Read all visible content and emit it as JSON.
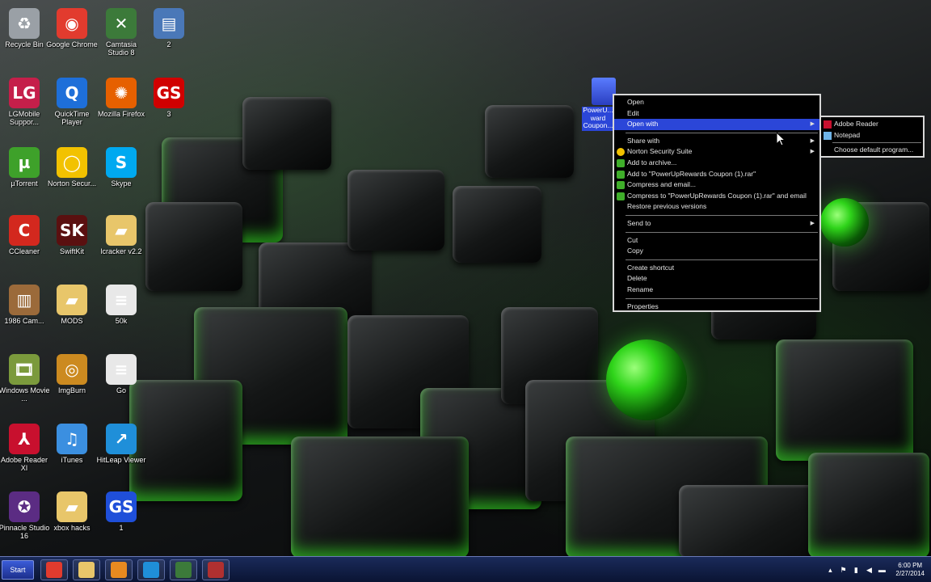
{
  "desktop": {
    "icons": [
      {
        "label": "Recycle Bin",
        "icon": "recycle-bin-icon",
        "color": "#9aa0a6",
        "glyph": "♻"
      },
      {
        "label": "Google Chrome",
        "icon": "chrome-icon",
        "color": "#e23b2e",
        "glyph": "◉"
      },
      {
        "label": "Camtasia Studio 8",
        "icon": "camtasia-icon",
        "color": "#3c7a3a",
        "glyph": "✕"
      },
      {
        "label": "2",
        "icon": "image-file-icon",
        "color": "#4a78b8",
        "glyph": "▤"
      },
      {
        "label": "LGMobile Suppor...",
        "icon": "lg-icon",
        "color": "#c51f4a",
        "glyph": "LG"
      },
      {
        "label": "QuickTime Player",
        "icon": "quicktime-icon",
        "color": "#1e6fd9",
        "glyph": "Q"
      },
      {
        "label": "Mozilla Firefox",
        "icon": "firefox-icon",
        "color": "#e66000",
        "glyph": "✺"
      },
      {
        "label": "3",
        "icon": "gamestop-icon",
        "color": "#d00000",
        "glyph": "GS"
      },
      {
        "label": "µTorrent",
        "icon": "utorrent-icon",
        "color": "#3ea12a",
        "glyph": "µ"
      },
      {
        "label": "Norton Secur...",
        "icon": "norton-icon",
        "color": "#f2c200",
        "glyph": "◯"
      },
      {
        "label": "Skype",
        "icon": "skype-icon",
        "color": "#00a9f0",
        "glyph": "S"
      },
      {
        "label": "CCleaner",
        "icon": "ccleaner-icon",
        "color": "#d3281e",
        "glyph": "C"
      },
      {
        "label": "SwiftKit",
        "icon": "swiftkit-icon",
        "color": "#5a1010",
        "glyph": "SK"
      },
      {
        "label": "lcracker v2.2",
        "icon": "folder-icon",
        "color": "#e8c66a",
        "glyph": "▰"
      },
      {
        "label": "1986 Cam...",
        "icon": "document-icon",
        "color": "#9b6a3a",
        "glyph": "▥"
      },
      {
        "label": "MODS",
        "icon": "folder-icon",
        "color": "#e8c66a",
        "glyph": "▰"
      },
      {
        "label": "50k",
        "icon": "text-file-icon",
        "color": "#e8e8e8",
        "glyph": "≡"
      },
      {
        "label": "Windows Movie ...",
        "icon": "movie-maker-icon",
        "color": "#7b9a3c",
        "glyph": "🎞"
      },
      {
        "label": "ImgBurn",
        "icon": "imgburn-icon",
        "color": "#cc8a20",
        "glyph": "◎"
      },
      {
        "label": "Go",
        "icon": "text-file-icon",
        "color": "#e8e8e8",
        "glyph": "≡"
      },
      {
        "label": "Adobe Reader XI",
        "icon": "adobe-reader-icon",
        "color": "#c8102e",
        "glyph": "⅄"
      },
      {
        "label": "iTunes",
        "icon": "itunes-icon",
        "color": "#3b8fe0",
        "glyph": "♫"
      },
      {
        "label": "HitLeap Viewer",
        "icon": "hitleap-icon",
        "color": "#1f8fd9",
        "glyph": "↗"
      },
      {
        "label": "Pinnacle Studio 16",
        "icon": "pinnacle-icon",
        "color": "#5b2c83",
        "glyph": "✪"
      },
      {
        "label": "xbox hacks",
        "icon": "folder-icon",
        "color": "#e8c66a",
        "glyph": "▰"
      },
      {
        "label": "1",
        "icon": "gamestop-icon",
        "color": "#1f4fd9",
        "glyph": "GS"
      }
    ],
    "selected_icon_label": "PowerU... ward Coupon..."
  },
  "context_menu": {
    "items": [
      {
        "label": "Open",
        "type": "item",
        "icon": ""
      },
      {
        "label": "Edit",
        "type": "item",
        "icon": ""
      },
      {
        "label": "Open with",
        "type": "submenu",
        "icon": "",
        "highlighted": true
      },
      {
        "type": "sep"
      },
      {
        "label": "Share with",
        "type": "submenu",
        "icon": ""
      },
      {
        "label": "Norton Security Suite",
        "type": "submenu",
        "icon": "norton-icon",
        "color": "#f2c200"
      },
      {
        "label": "Add to archive...",
        "type": "item",
        "icon": "winrar-icon",
        "color": "#3fae2a"
      },
      {
        "label": "Add to \"PowerUpRewards Coupon (1).rar\"",
        "type": "item",
        "icon": "winrar-icon",
        "color": "#3fae2a"
      },
      {
        "label": "Compress and email...",
        "type": "item",
        "icon": "winrar-icon",
        "color": "#3fae2a"
      },
      {
        "label": "Compress to \"PowerUpRewards Coupon (1).rar\" and email",
        "type": "item",
        "icon": "winrar-icon",
        "color": "#3fae2a"
      },
      {
        "label": "Restore previous versions",
        "type": "item",
        "icon": ""
      },
      {
        "type": "sep"
      },
      {
        "label": "Send to",
        "type": "submenu",
        "icon": ""
      },
      {
        "type": "sep"
      },
      {
        "label": "Cut",
        "type": "item",
        "icon": ""
      },
      {
        "label": "Copy",
        "type": "item",
        "icon": ""
      },
      {
        "type": "sep"
      },
      {
        "label": "Create shortcut",
        "type": "item",
        "icon": ""
      },
      {
        "label": "Delete",
        "type": "item",
        "icon": ""
      },
      {
        "label": "Rename",
        "type": "item",
        "icon": ""
      },
      {
        "type": "sep"
      },
      {
        "label": "Properties",
        "type": "item",
        "icon": ""
      }
    ]
  },
  "open_with_submenu": {
    "items": [
      {
        "label": "Adobe Reader",
        "icon": "adobe-reader-icon",
        "color": "#c8102e"
      },
      {
        "label": "Notepad",
        "icon": "notepad-icon",
        "color": "#6fb4e8"
      }
    ],
    "choose_default": "Choose default program..."
  },
  "taskbar": {
    "start_label": "Start",
    "pinned": [
      {
        "name": "chrome",
        "icon": "chrome-icon",
        "color": "#e23b2e"
      },
      {
        "name": "explorer",
        "icon": "folder-icon",
        "color": "#e8c66a"
      },
      {
        "name": "media-player",
        "icon": "media-player-icon",
        "color": "#e88a20"
      },
      {
        "name": "hitleap",
        "icon": "hitleap-icon",
        "color": "#1f8fd9"
      },
      {
        "name": "camtasia",
        "icon": "camtasia-icon",
        "color": "#3c7a3a"
      },
      {
        "name": "camtasia-recorder",
        "icon": "recorder-icon",
        "color": "#b03030"
      }
    ],
    "clock_time": "6:00 PM",
    "clock_date": "2/27/2014"
  }
}
